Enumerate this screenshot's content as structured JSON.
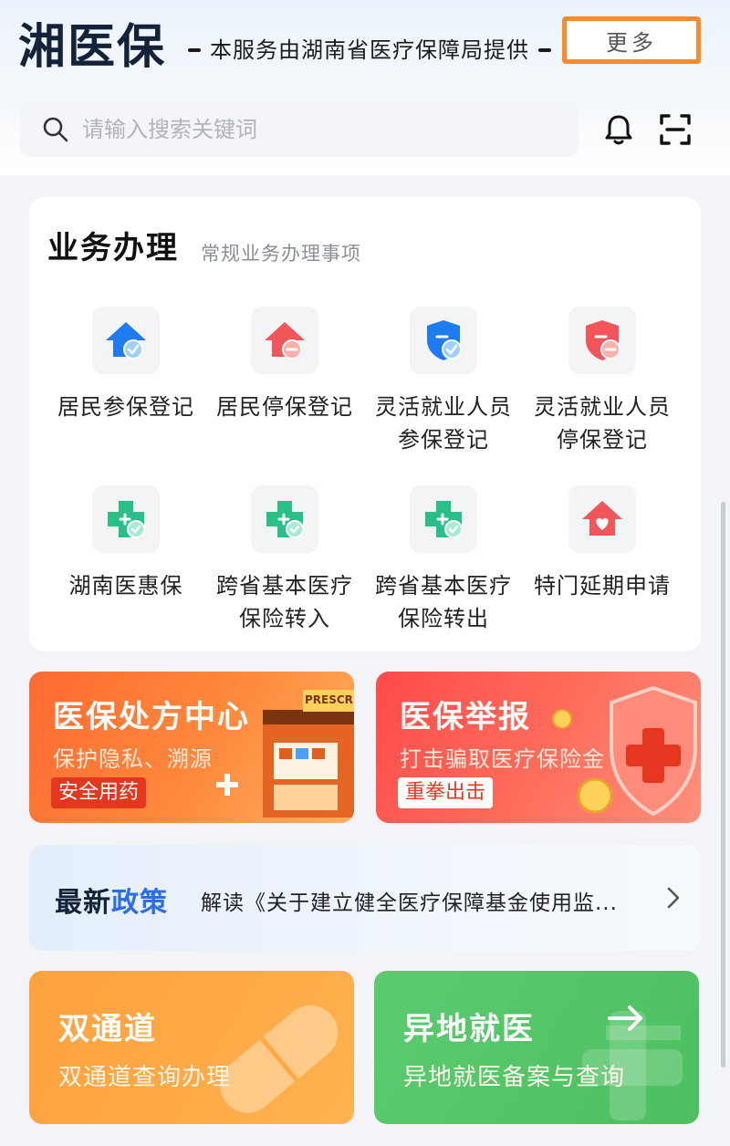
{
  "header": {
    "brand": "湘医保",
    "tagline": "本服务由湖南省医疗保障局提供",
    "search_placeholder": "请输入搜索关键词"
  },
  "services": {
    "title": "业务办理",
    "subtitle": "常规业务办理事项",
    "more_label": "更多",
    "items": [
      {
        "label": "居民参保登记",
        "icon": "house-blue-check-icon",
        "color": "#1e7cf0"
      },
      {
        "label": "居民停保登记",
        "icon": "house-red-minus-icon",
        "color": "#f2555a"
      },
      {
        "label": "灵活就业人员参保登记",
        "icon": "shield-blue-check-icon",
        "color": "#1e7cf0"
      },
      {
        "label": "灵活就业人员停保登记",
        "icon": "shield-red-minus-icon",
        "color": "#f2555a"
      },
      {
        "label": "湖南医惠保",
        "icon": "medical-cross-green-icon",
        "color": "#2bbf88"
      },
      {
        "label": "跨省基本医疗保险转入",
        "icon": "medical-cross-green-in-icon",
        "color": "#2bbf88"
      },
      {
        "label": "跨省基本医疗保险转出",
        "icon": "medical-cross-green-out-icon",
        "color": "#2bbf88"
      },
      {
        "label": "特门延期申请",
        "icon": "house-heart-red-icon",
        "color": "#f2555a"
      }
    ]
  },
  "banners": {
    "prescription": {
      "title": "医保处方中心",
      "subtitle": "保护隐私、溯源",
      "tag": "安全用药",
      "decor_text": "PRESCRIP"
    },
    "report": {
      "title": "医保举报",
      "subtitle": "打击骗取医疗保险金",
      "tag": "重拳出击"
    }
  },
  "policy": {
    "tag_a": "最新",
    "tag_b": "政策",
    "text": "解读《关于建立健全医疗保障基金使用监..."
  },
  "tiles": {
    "dual": {
      "title": "双通道",
      "subtitle": "双通道查询办理"
    },
    "remote": {
      "title": "异地就医",
      "subtitle": "异地就医备案与查询"
    }
  }
}
